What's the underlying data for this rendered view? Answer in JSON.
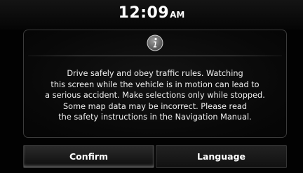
{
  "status_bar": {
    "time": "12:09",
    "ampm": "AM"
  },
  "dialog": {
    "icon": "info-icon",
    "message_lines": [
      "Drive safely and obey traffic rules. Watching",
      "this screen while the vehicle is in motion can lead to",
      "a serious accident. Make selections only while stopped.",
      "Some map data may be incorrect. Please read",
      "the safety instructions in the Navigation Manual."
    ]
  },
  "buttons": {
    "confirm_label": "Confirm",
    "language_label": "Language"
  },
  "colors": {
    "background": "#020202",
    "border": "#3b3b3b",
    "text": "#ffffff"
  }
}
